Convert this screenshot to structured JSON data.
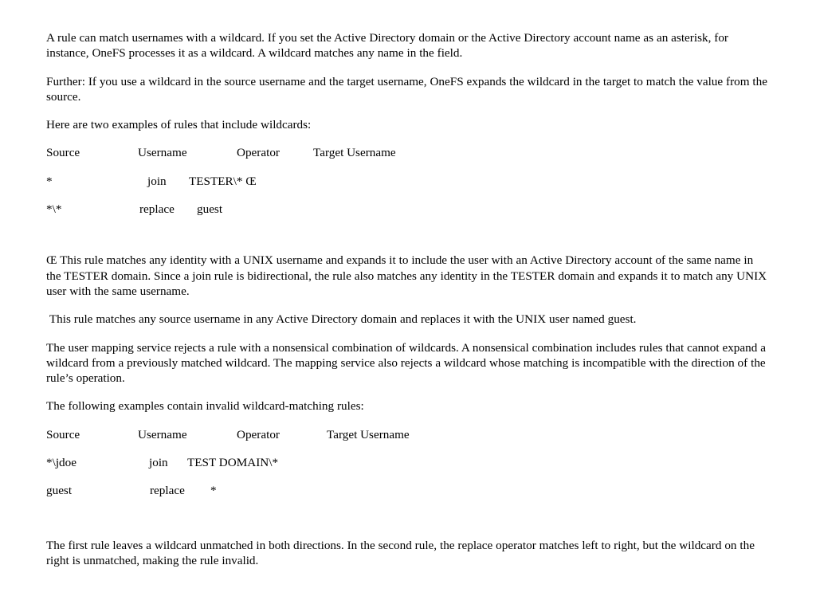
{
  "document": {
    "paragraphs": {
      "intro_wildcard": "A rule can match usernames with a wildcard. If you set the Active Directory domain or the Active Directory account name as an asterisk, for instance, OneFS processes it as a wildcard. A wildcard matches any name in the field.",
      "further_expansion": "Further: If you use a wildcard in the source username and the target username, OneFS expands the wildcard in the target to match the value from the source.",
      "examples_lead_in": "Here are two examples of rules that include wildcards:",
      "footnote_join_explanation": "Œ This rule matches any identity with a UNIX username and expands it to include the user with an Active Directory account of the same name in the TESTER domain. Since a join rule is bidirectional, the rule also matches any identity in the TESTER domain and expands it to match any UNIX user with the same username.",
      "footnote_replace_explanation": " This rule matches any source username in any Active Directory domain and replaces it with the UNIX user named guest.",
      "nonsensical_rules": "The user mapping service rejects a rule with a nonsensical combination of wildcards. A nonsensical combination includes rules that cannot expand a wildcard from a previously matched wildcard. The mapping service also rejects a wildcard whose matching is incompatible with the direction of the rule’s operation.",
      "invalid_examples_lead_in": "The following examples contain invalid wildcard-matching rules:",
      "invalid_explanation": "The first rule leaves a wildcard unmatched in both directions. In the second rule, the replace operator matches left to right, but the wildcard on the right is unmatched, making the rule invalid."
    },
    "valid_rules_table": {
      "headers": {
        "source": "Source",
        "username": "Username",
        "operator": "Operator",
        "target": "Target Username"
      },
      "rows": [
        {
          "source": "*",
          "username": "join",
          "operator": "TESTER\\* Œ",
          "target": ""
        },
        {
          "source": "*\\*",
          "username": "replace",
          "operator": "guest",
          "target": ""
        }
      ]
    },
    "invalid_rules_table": {
      "headers": {
        "source": "Source",
        "username": "Username",
        "operator": "Operator",
        "target": "Target Username"
      },
      "rows": [
        {
          "source": "*\\jdoe",
          "username": "join",
          "operator": "TEST DOMAIN\\*",
          "target": ""
        },
        {
          "source": "guest",
          "username": "replace",
          "operator": "*",
          "target": ""
        }
      ]
    }
  },
  "theme": {
    "background": "#ffffff",
    "text_color": "#000000"
  }
}
